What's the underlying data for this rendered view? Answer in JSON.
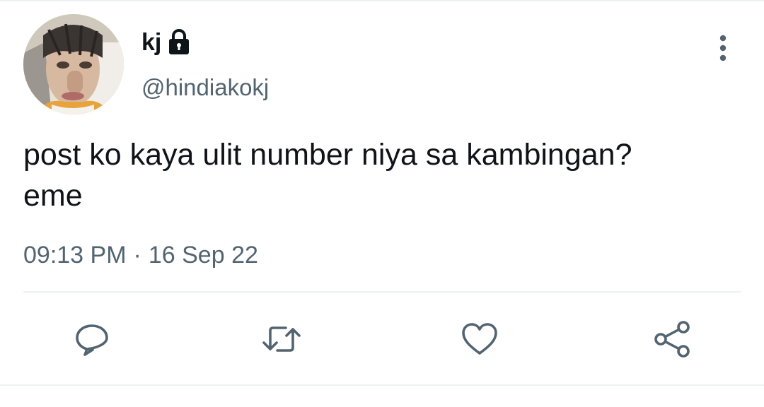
{
  "tweet": {
    "author": {
      "display_name": "kj",
      "handle": "@hindiakokj",
      "protected_icon": "lock-icon"
    },
    "text": "post ko kaya ulit number niya sa kambingan?\neme",
    "time": "09:13 PM",
    "separator": "·",
    "date": "16 Sep 22"
  },
  "actions": {
    "reply_icon": "comment-icon",
    "retweet_icon": "retweet-icon",
    "like_icon": "heart-icon",
    "share_icon": "share-icon"
  },
  "menu": {
    "icon": "more-vertical-icon"
  },
  "colors": {
    "text_primary": "#0f1419",
    "text_secondary": "#536471",
    "icon": "#536471",
    "divider": "#eef1f4"
  }
}
